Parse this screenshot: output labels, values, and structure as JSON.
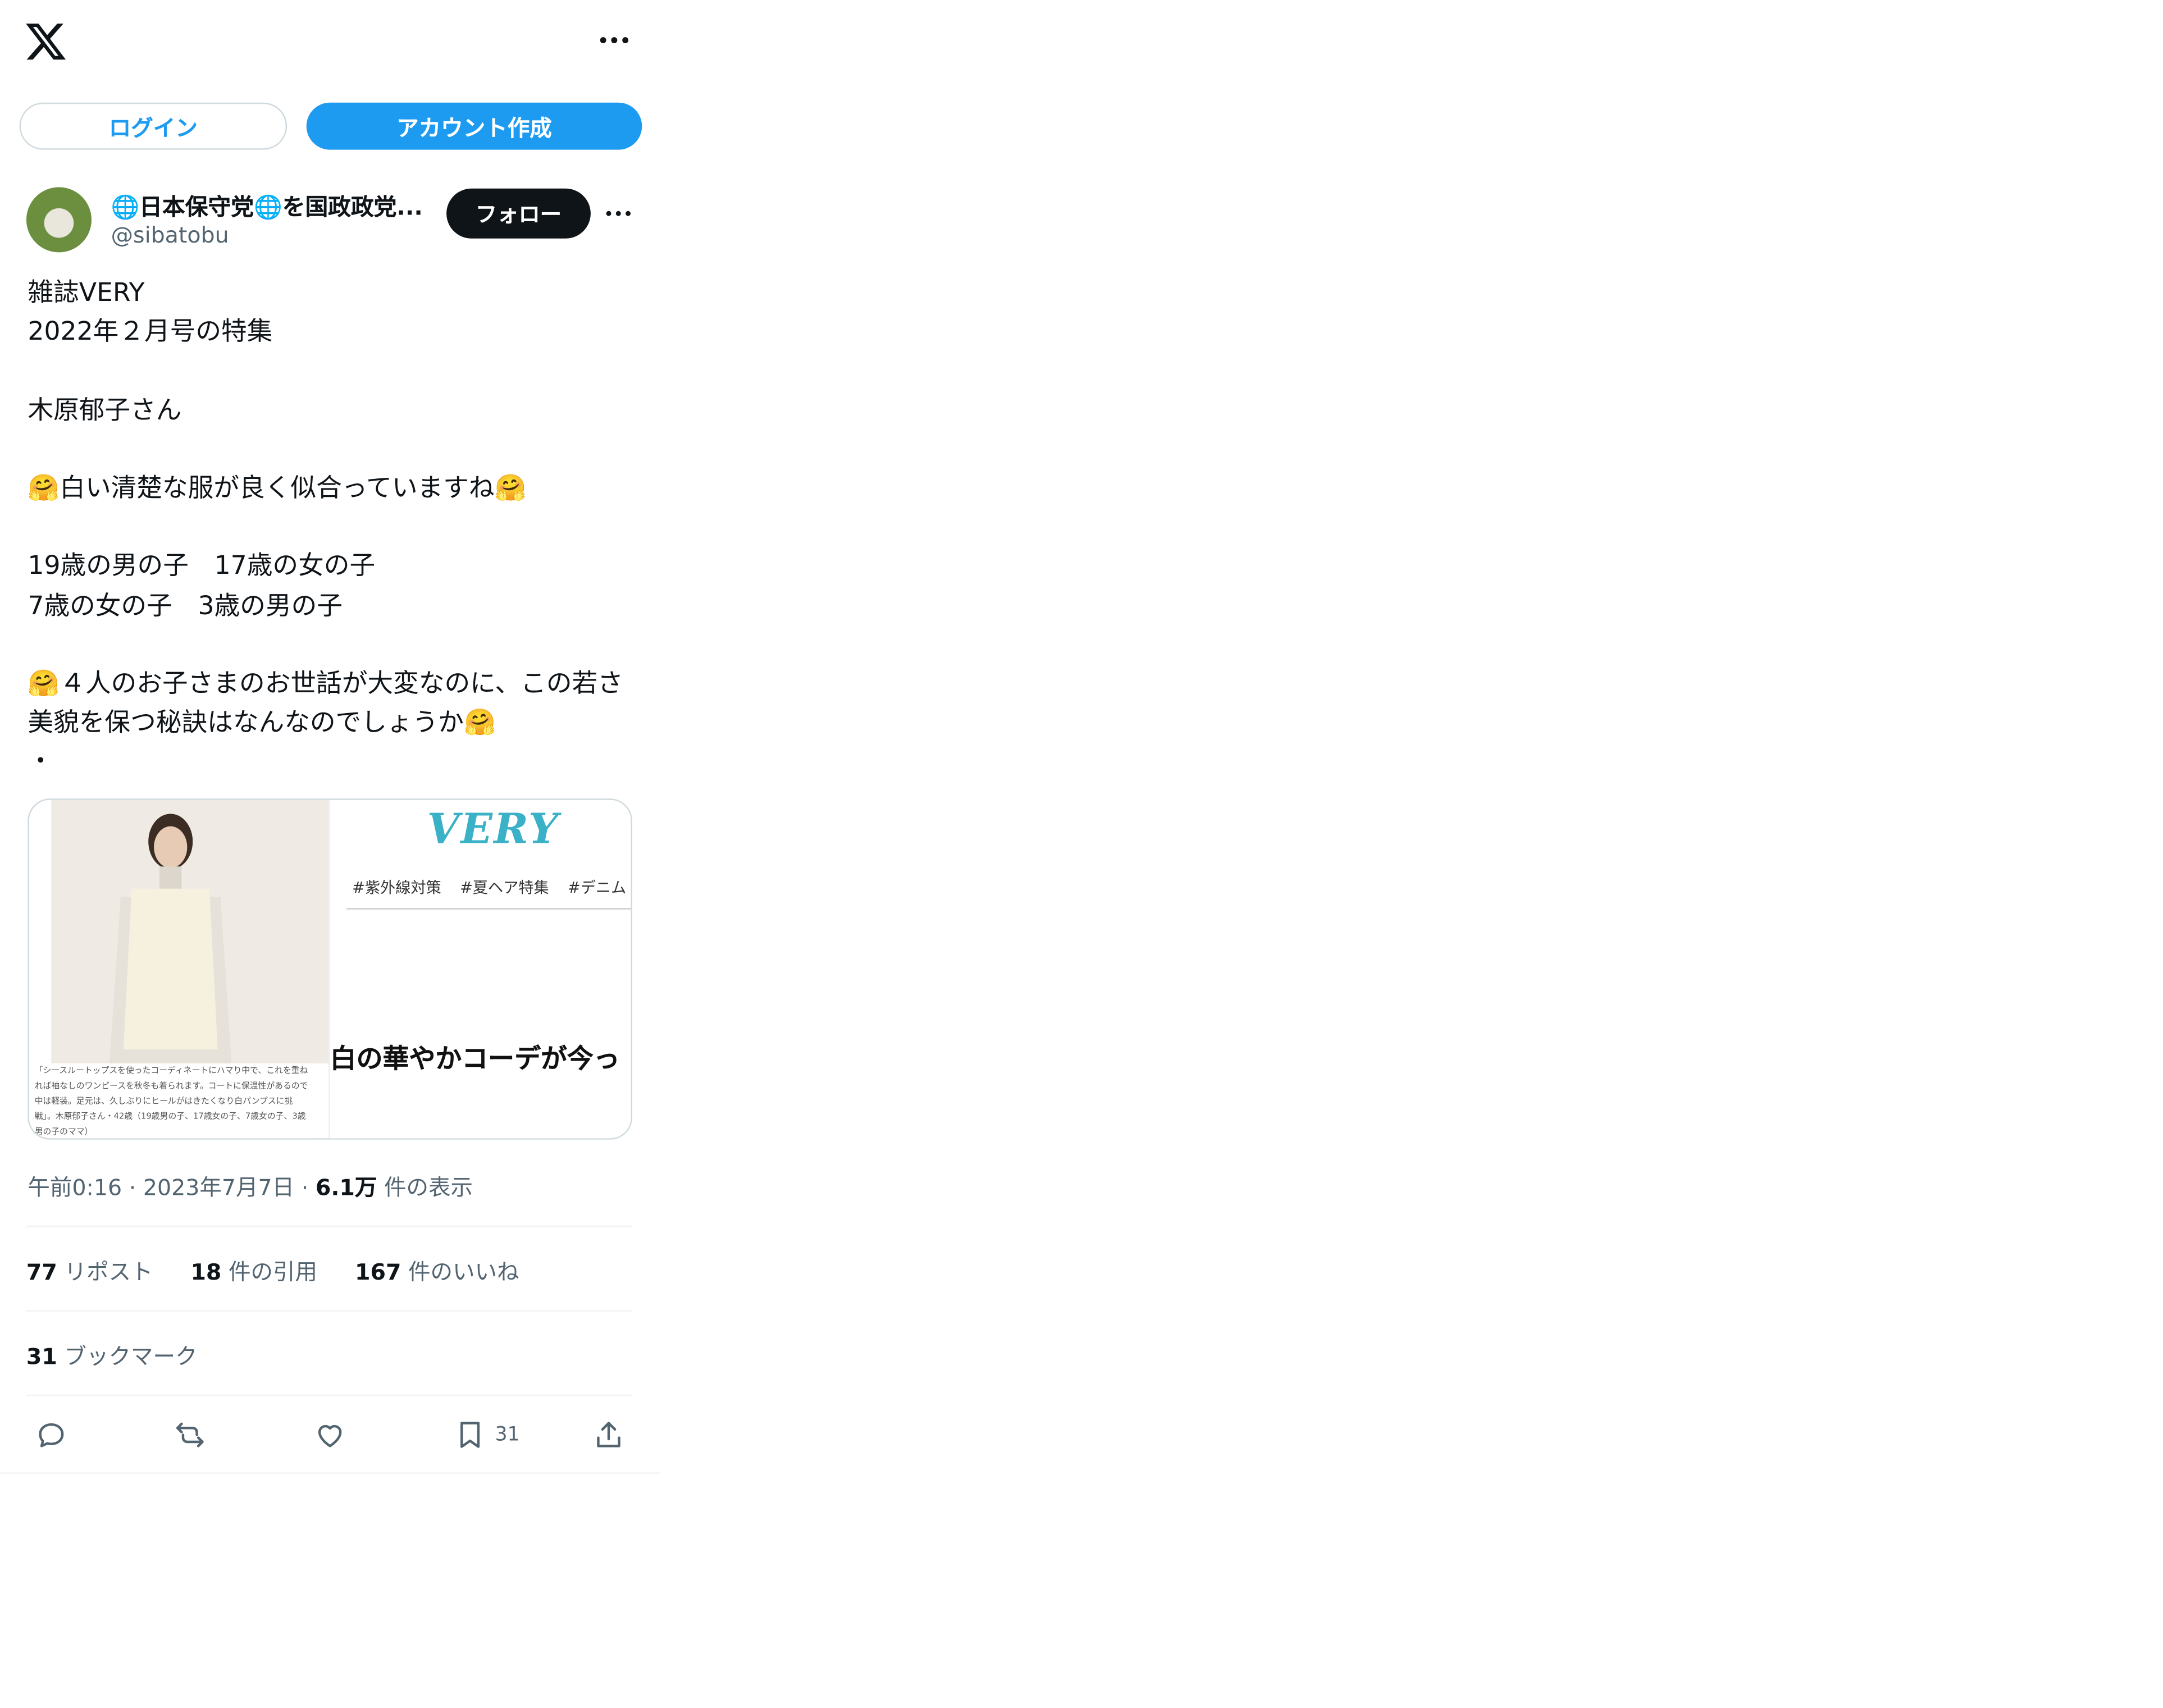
{
  "header": {
    "logo_icon": "x-logo-icon",
    "more_icon": "more-horizontal-icon"
  },
  "auth": {
    "login_label": "ログイン",
    "create_account_label": "アカウント作成"
  },
  "author": {
    "display_name": "🌐日本保守党🌐を国政政党...",
    "handle": "@sibatobu",
    "follow_label": "フォロー"
  },
  "tweet": {
    "text": "雑誌VERY\n2022年２月号の特集\n\n木原郁子さん\n\n🤗白い清楚な服が良く似合っていますね🤗\n\n19歳の男の子　17歳の女の子\n7歳の女の子　3歳の男の子\n\n🤗４人のお子さまのお世話が大変なのに、この若さ美貌を保つ秘訣はなんなのでしょうか🤗\n・"
  },
  "card": {
    "logo": "VERY",
    "tags": [
      "#紫外線対策",
      "#夏ヘア特集",
      "#デニム"
    ],
    "headline": "白の華やかコーデが今っ",
    "caption": "「シースルートップスを使ったコーディネートにハマり中で、これを重ねれば袖なしのワンピースを秋冬も着られます。コートに保温性があるので中は軽装。足元は、久しぶりにヒールがはきたくなり白パンプスに挑戦」。木原郁子さん・42歳（19歳男の子、17歳女の子、7歳女の子、3歳男の子のママ）"
  },
  "meta": {
    "time": "午前0:16",
    "date": "2023年7月7日",
    "views_count": "6.1万",
    "views_label": "件の表示"
  },
  "stats": {
    "reposts_count": "77",
    "reposts_label": "リポスト",
    "quotes_count": "18",
    "quotes_label": "件の引用",
    "likes_count": "167",
    "likes_label": "件のいいね",
    "bookmarks_count": "31",
    "bookmarks_label": "ブックマーク"
  },
  "actions": {
    "reply_icon": "reply-icon",
    "repost_icon": "repost-icon",
    "like_icon": "heart-icon",
    "bookmark_icon": "bookmark-icon",
    "bookmark_count": "31",
    "share_icon": "share-icon"
  },
  "colors": {
    "accent": "#1d9bf0",
    "text": "#0f1419",
    "muted": "#536471",
    "border": "#cfd9de",
    "very_logo": "#3ab1c7"
  }
}
